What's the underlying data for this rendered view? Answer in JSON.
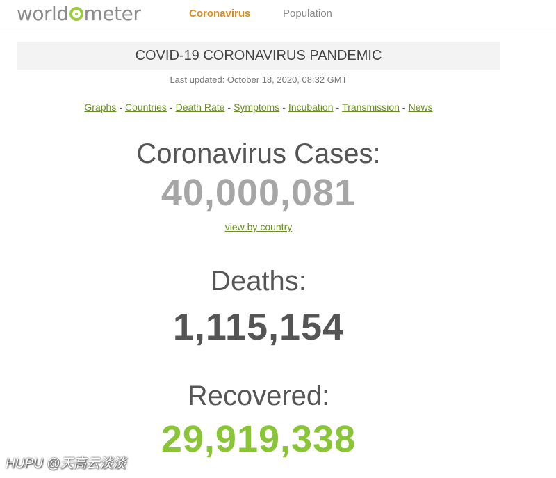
{
  "nav": {
    "logo_left": "world",
    "logo_right": "meter",
    "links": [
      "Coronavirus",
      "Population"
    ]
  },
  "banner": {
    "title": "COVID-19 CORONAVIRUS PANDEMIC",
    "updated": "Last updated: October 18, 2020, 08:32 GMT"
  },
  "sublinks": [
    "Graphs",
    "Countries",
    "Death Rate",
    "Symptoms",
    "Incubation",
    "Transmission",
    "News"
  ],
  "separator": "-",
  "cases": {
    "label": "Coronavirus Cases:",
    "value": "40,000,081",
    "link": "view by country"
  },
  "deaths": {
    "label": "Deaths:",
    "value": "1,115,154"
  },
  "recovered": {
    "label": "Recovered:",
    "value": "29,919,338"
  },
  "watermark": "HUPU @天高云淡淡",
  "colors": {
    "brand_green": "#9ccc3c",
    "nav_active": "#d98c1f",
    "link_green": "#6b8e23",
    "cases_gray": "#a6a6a6",
    "deaths_gray": "#555555",
    "recovered_green": "#8ac537"
  }
}
